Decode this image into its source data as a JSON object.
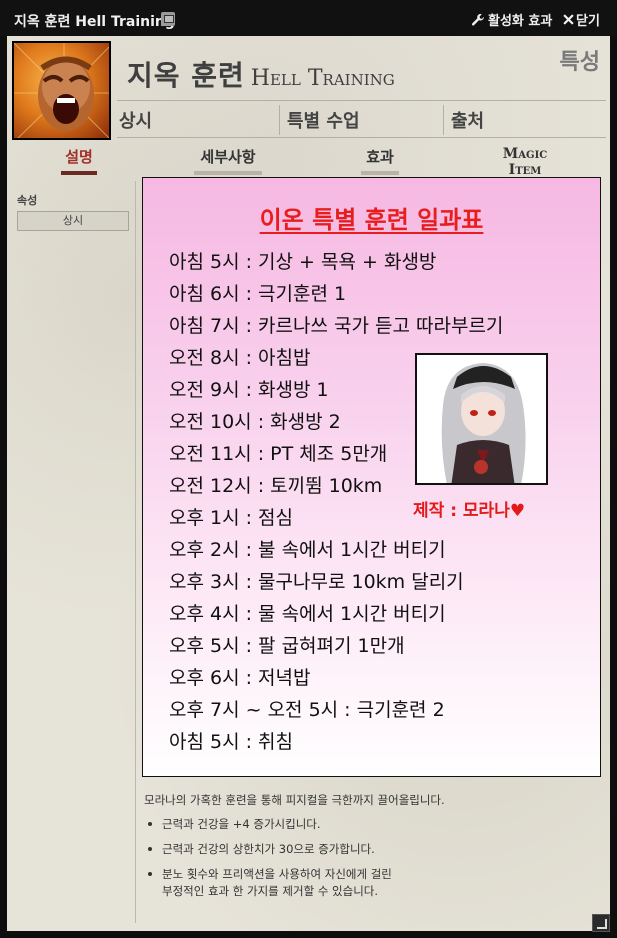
{
  "window": {
    "title": "지옥 훈련 Hell Training",
    "effect_label": "활성화 효과",
    "close_label": "닫기"
  },
  "header": {
    "name_ko": "지옥 훈련",
    "name_en": "Hell Training",
    "category": "특성",
    "meta": [
      "상시",
      "특별 수업",
      "출처"
    ]
  },
  "tabs": [
    {
      "label": "설명",
      "active": true
    },
    {
      "label": "세부사항",
      "active": false
    },
    {
      "label": "효과",
      "active": false
    },
    {
      "label": "Magic Item",
      "active": false
    }
  ],
  "sidebar": {
    "label": "속성",
    "button": "상시"
  },
  "card": {
    "title": "이온 특별 훈련 일과표",
    "schedule": [
      "아침 5시 : 기상 + 목욕 + 화생방",
      "아침 6시 : 극기훈련 1",
      "아침 7시 : 카르나쓰 국가 듣고 따라부르기",
      "오전 8시 : 아침밥",
      "오전 9시 : 화생방 1",
      "오전 10시 : 화생방 2",
      "오전 11시 : PT 체조 5만개",
      "오전 12시 : 토끼뜀 10km",
      "오후 1시 : 점심",
      "오후 2시 : 불 속에서 1시간 버티기",
      "오후 3시 : 물구나무로 10km 달리기",
      "오후 4시 : 물 속에서 1시간 버티기",
      "오후 5시 : 팔 굽혀펴기 1만개",
      "오후 6시 : 저녁밥",
      "오후 7시 ~ 오전 5시 : 극기훈련 2",
      "아침 5시 : 취침"
    ],
    "credit": "제작 : 모라나♥"
  },
  "description": "모라나의 가혹한 훈련을 통해 피지컬을 극한까지 끌어올립니다.",
  "effects": [
    "근력과 건강을 +4 증가시킵니다.",
    "근력과 건강의 상한치가 30으로 증가합니다.",
    "분노 횟수와 프리액션을 사용하여 자신에게 걸린\n부정적인 효과 한 가지를 제거할 수 있습니다."
  ],
  "colors": {
    "title_red": "#e81e1e",
    "active_tab": "#a0302a",
    "card_pink": "#f6b8e2"
  }
}
